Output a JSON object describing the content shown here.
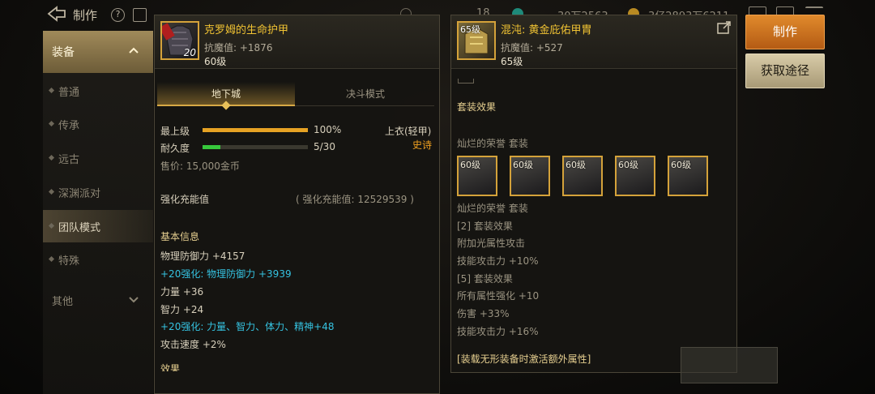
{
  "topbar": {
    "title": "制作",
    "help": "?",
    "res1": "18",
    "res2": "30万2563",
    "res3": "3亿2893万6211"
  },
  "sidebar": {
    "header": "装备",
    "items": [
      {
        "label": "普通"
      },
      {
        "label": "传承"
      },
      {
        "label": "远古"
      },
      {
        "label": "深渊派对"
      },
      {
        "label": "团队模式"
      },
      {
        "label": "特殊"
      }
    ],
    "other": "其他"
  },
  "left_item": {
    "name": "克罗姆的生命护甲",
    "resist": "抗魔值: +1876",
    "level": "60级",
    "icon_badge": "20",
    "tabs": [
      "地下城",
      "决斗模式"
    ],
    "max_level_label": "最上级",
    "max_level_value": "100%",
    "max_level_fraction": 1.0,
    "durability_label": "耐久度",
    "durability_value": "5/30",
    "durability_fraction": 0.1667,
    "slot_type": "上衣(轻甲)",
    "rarity": "史诗",
    "price": "售价: 15,000金币",
    "enhance_label": "强化充能值",
    "enhance_value": "( 强化充能值: 12529539 )",
    "basic_title": "基本信息",
    "stats": [
      {
        "text": "物理防御力 +4157",
        "cyan": false
      },
      {
        "text": "+20强化: 物理防御力 +3939",
        "cyan": true
      },
      {
        "text": "力量 +36",
        "cyan": false
      },
      {
        "text": "智力 +24",
        "cyan": false
      },
      {
        "text": "+20强化: 力量、智力、体力、精神+48",
        "cyan": true
      },
      {
        "text": "攻击速度 +2%",
        "cyan": false
      }
    ],
    "cut_text": "效果"
  },
  "right_item": {
    "name": "混沌: 黄金庇佑甲胄",
    "resist": "抗魔值: +527",
    "level": "65级",
    "icon_badge": "65级",
    "set_title": "套装效果",
    "set_name": "灿烂的荣誉 套装",
    "slots": [
      "60级",
      "60级",
      "60级",
      "60级",
      "60级"
    ],
    "set_name2": "灿烂的荣誉 套装",
    "effects": [
      "[2] 套装效果",
      "附加光属性攻击",
      "技能攻击力 +10%",
      "[5] 套装效果",
      "所有属性强化 +10",
      "伤害 +33%",
      "技能攻击力 +16%"
    ],
    "footer": "[装载无形装备时激活额外属性]"
  },
  "buttons": {
    "make": "制作",
    "get": "获取途径"
  },
  "colors": {
    "gold_title": "#f2c433",
    "cyan_stat": "#35c2e0",
    "rarity": "#f0a020",
    "bar_gold": "#e6a224",
    "bar_green": "#37c83c",
    "make_button": "#d07a24"
  }
}
